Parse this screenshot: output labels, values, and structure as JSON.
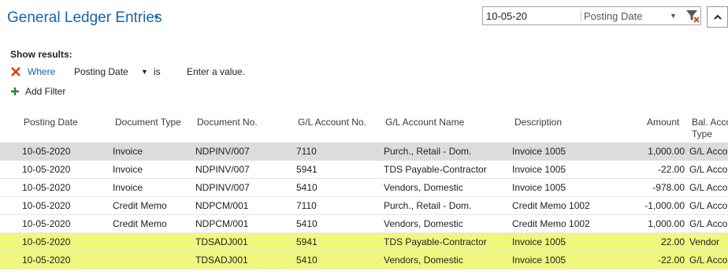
{
  "page": {
    "title": "General Ledger Entries"
  },
  "search": {
    "value": "10-05-20",
    "field": "Posting Date"
  },
  "filter_pane": {
    "show_results_label": "Show results:",
    "where_label": "Where",
    "field": "Posting Date",
    "operator": "is",
    "value_placeholder": "Enter a value.",
    "add_filter_label": "Add Filter"
  },
  "table": {
    "columns": [
      "Posting Date",
      "Document Type",
      "Document No.",
      "G/L Account No.",
      "G/L Account Name",
      "Description",
      "Amount",
      "Bal. Account Type"
    ],
    "rows": [
      {
        "posting_date": "10-05-2020",
        "document_type": "Invoice",
        "document_no": "NDPINV/007",
        "account_no": "7110",
        "account_name": "Purch., Retail - Dom.",
        "description": "Invoice 1005",
        "amount": "1,000.00",
        "bal_account_type": "G/L Account",
        "state": "selected"
      },
      {
        "posting_date": "10-05-2020",
        "document_type": "Invoice",
        "document_no": "NDPINV/007",
        "account_no": "5941",
        "account_name": "TDS Payable-Contractor",
        "description": "Invoice 1005",
        "amount": "-22.00",
        "bal_account_type": "G/L Account",
        "state": "normal"
      },
      {
        "posting_date": "10-05-2020",
        "document_type": "Invoice",
        "document_no": "NDPINV/007",
        "account_no": "5410",
        "account_name": "Vendors, Domestic",
        "description": "Invoice 1005",
        "amount": "-978.00",
        "bal_account_type": "G/L Account",
        "state": "normal"
      },
      {
        "posting_date": "10-05-2020",
        "document_type": "Credit Memo",
        "document_no": "NDPCM/001",
        "account_no": "7110",
        "account_name": "Purch., Retail - Dom.",
        "description": "Credit Memo 1002",
        "amount": "-1,000.00",
        "bal_account_type": "G/L Account",
        "state": "normal"
      },
      {
        "posting_date": "10-05-2020",
        "document_type": "Credit Memo",
        "document_no": "NDPCM/001",
        "account_no": "5410",
        "account_name": "Vendors, Domestic",
        "description": "Credit Memo 1002",
        "amount": "1,000.00",
        "bal_account_type": "G/L Account",
        "state": "normal"
      },
      {
        "posting_date": "10-05-2020",
        "document_type": "",
        "document_no": "TDSADJ001",
        "account_no": "5941",
        "account_name": "TDS Payable-Contractor",
        "description": "Invoice 1005",
        "amount": "22.00",
        "bal_account_type": "Vendor",
        "state": "highlighted"
      },
      {
        "posting_date": "10-05-2020",
        "document_type": "",
        "document_no": "TDSADJ001",
        "account_no": "5410",
        "account_name": "Vendors, Domestic",
        "description": "Invoice 1005",
        "amount": "-22.00",
        "bal_account_type": "G/L Account",
        "state": "highlighted"
      }
    ]
  },
  "icons": {
    "title_menu": "chevron-down-icon",
    "search_field_menu": "chevron-down-icon",
    "clear_filter": "clear-filter-icon",
    "collapse": "chevron-up-icon",
    "remove_filter": "close-icon",
    "add_filter": "plus-icon"
  },
  "colors": {
    "title": "#1565a8",
    "where_link": "#1565a8",
    "remove_icon": "#d83b01",
    "add_icon": "#2e7d32",
    "selected_row": "#dcdcdc",
    "highlighted_row": "#f0f77d"
  }
}
